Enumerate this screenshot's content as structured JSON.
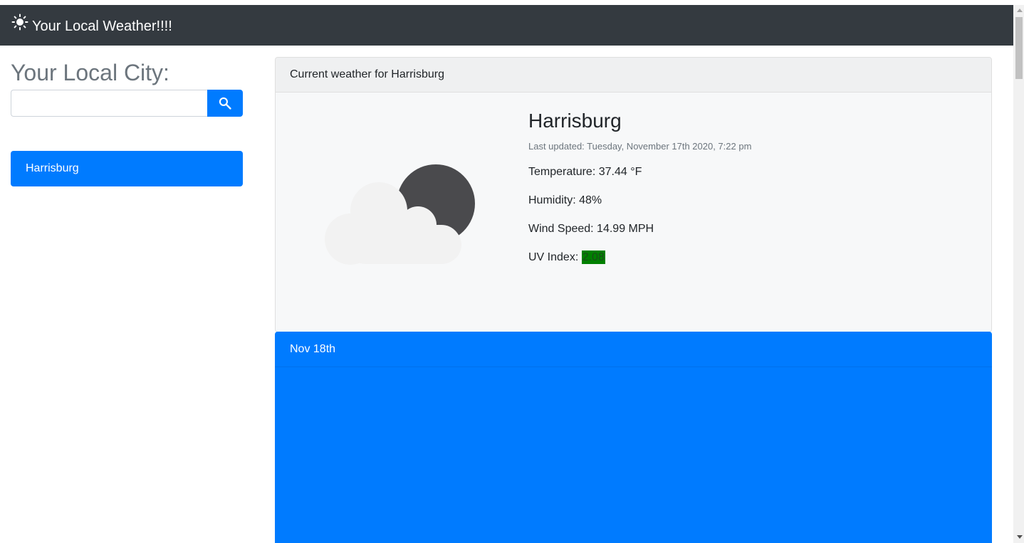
{
  "navbar": {
    "title": "Your Local Weather!!!!",
    "icon": "sun-icon"
  },
  "sidebar": {
    "title": "Your Local City:",
    "search": {
      "value": "",
      "placeholder": "",
      "button_icon": "search-icon"
    },
    "history": [
      {
        "label": "Harrisburg"
      }
    ]
  },
  "current": {
    "header": "Current weather for Harrisburg",
    "city": "Harrisburg",
    "last_updated": "Last updated: Tuesday, November 17th 2020, 7:22 pm",
    "temperature": "Temperature: 37.44 °F",
    "humidity": "Humidity: 48%",
    "wind": "Wind Speed: 14.99 MPH",
    "uv_label": "UV Index: ",
    "uv_value": "2.08",
    "icon": "partly-cloudy-night-icon"
  },
  "forecast": {
    "header": "Nov 18th"
  },
  "colors": {
    "navbar": "#343a40",
    "primary": "#007bff",
    "uv_low": "#008000"
  }
}
